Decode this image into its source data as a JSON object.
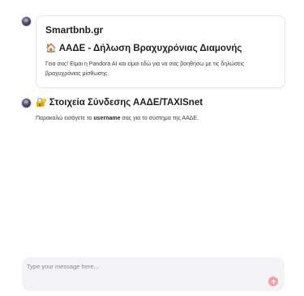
{
  "messages": [
    {
      "brand": "Smartbnb.gr",
      "title_emoji": "🏠",
      "title": "ΑΑΔΕ - Δήλωση Βραχυχρόνιας Διαμονής",
      "body": "Γεια σας! Είμαι η Pandora AI και είμαι εδώ για να σας βοηθήσω με τις δηλώσεις βραχυχρόνιας μίσθωσης."
    },
    {
      "title_emoji": "🔐",
      "title": "Στοιχεία Σύνδεσης ΑΑΔΕ/TAXISnet",
      "body_before": "Παρακαλώ εισάγετε το ",
      "body_bold": "username",
      "body_after": " σας για το σύστημα της ΑΑΔΕ."
    }
  ],
  "composer": {
    "placeholder": "Type your message here...",
    "value": "",
    "send_icon": "arrow-up-icon",
    "send_color": "#f4a0a8"
  }
}
